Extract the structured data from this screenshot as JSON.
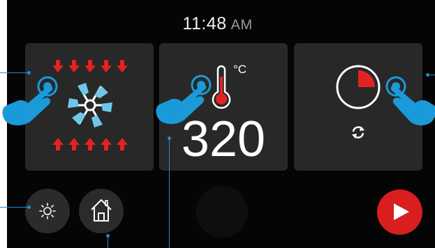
{
  "header": {
    "time": "11:48",
    "ampm": "AM"
  },
  "cards": {
    "fan": {
      "icon": "convection-fan-icon"
    },
    "temperature": {
      "unit": "°C",
      "value": "320",
      "icon": "thermometer-icon"
    },
    "timer": {
      "icon": "timer-icon",
      "sub_icon": "repeat-icon"
    }
  },
  "bottom_bar": {
    "light_icon": "sun-icon",
    "home_icon": "home-icon",
    "start_icon": "play-icon"
  },
  "colors": {
    "background": "#050505",
    "card": "#282828",
    "accent_red": "#e32222",
    "hand_blue": "#1a9ad9",
    "fan_blue": "#6ec6e8"
  }
}
